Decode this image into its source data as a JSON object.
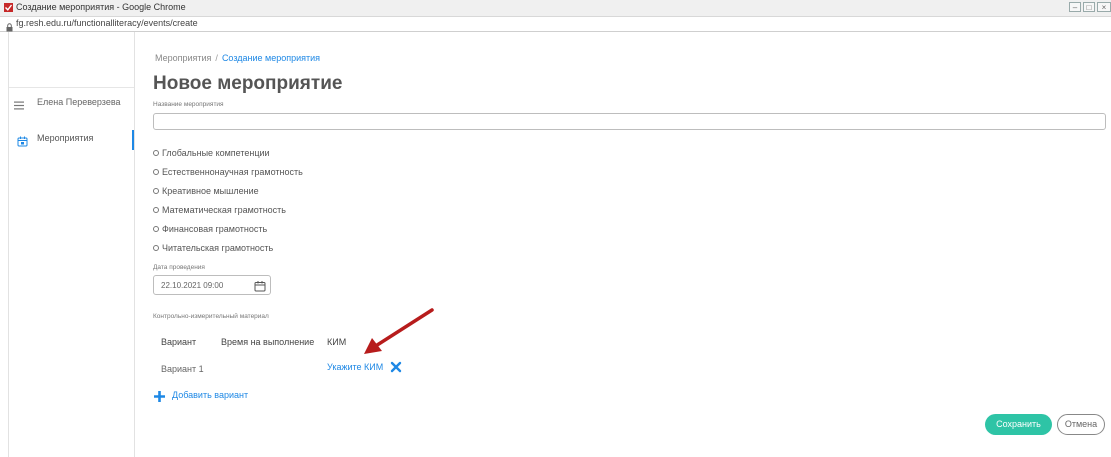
{
  "window": {
    "title": "Создание мероприятия - Google Chrome",
    "url": "fg.resh.edu.ru/functionalliteracy/events/create"
  },
  "sidebar": {
    "user_name": "Елена Переверзева",
    "items": [
      {
        "label": "Мероприятия",
        "icon": "calendar-icon"
      }
    ]
  },
  "breadcrumb": {
    "parent": "Мероприятия",
    "separator": "/",
    "current": "Создание мероприятия"
  },
  "page": {
    "title": "Новое мероприятие"
  },
  "form": {
    "name_label": "Название мероприятия",
    "name_value": "",
    "options": [
      "Глобальные компетенции",
      "Естественнонаучная грамотность",
      "Креативное мышление",
      "Математическая грамотность",
      "Финансовая грамотность",
      "Читательская грамотность"
    ],
    "date_label": "Дата проведения",
    "date_value": "22.10.2021 09:00",
    "material_label": "Контрольно-измерительный материал",
    "table": {
      "headers": [
        "Вариант",
        "Время на выполнение",
        "КИМ"
      ],
      "rows": [
        {
          "variant": "Вариант 1",
          "time": "",
          "kim_link": "Укажите КИМ"
        }
      ]
    },
    "add_variant": "Добавить вариант"
  },
  "buttons": {
    "save": "Сохранить",
    "cancel": "Отмена"
  },
  "colors": {
    "accent": "#1e88e5",
    "save": "#2ec4a6",
    "arrow": "#b71c1c"
  }
}
